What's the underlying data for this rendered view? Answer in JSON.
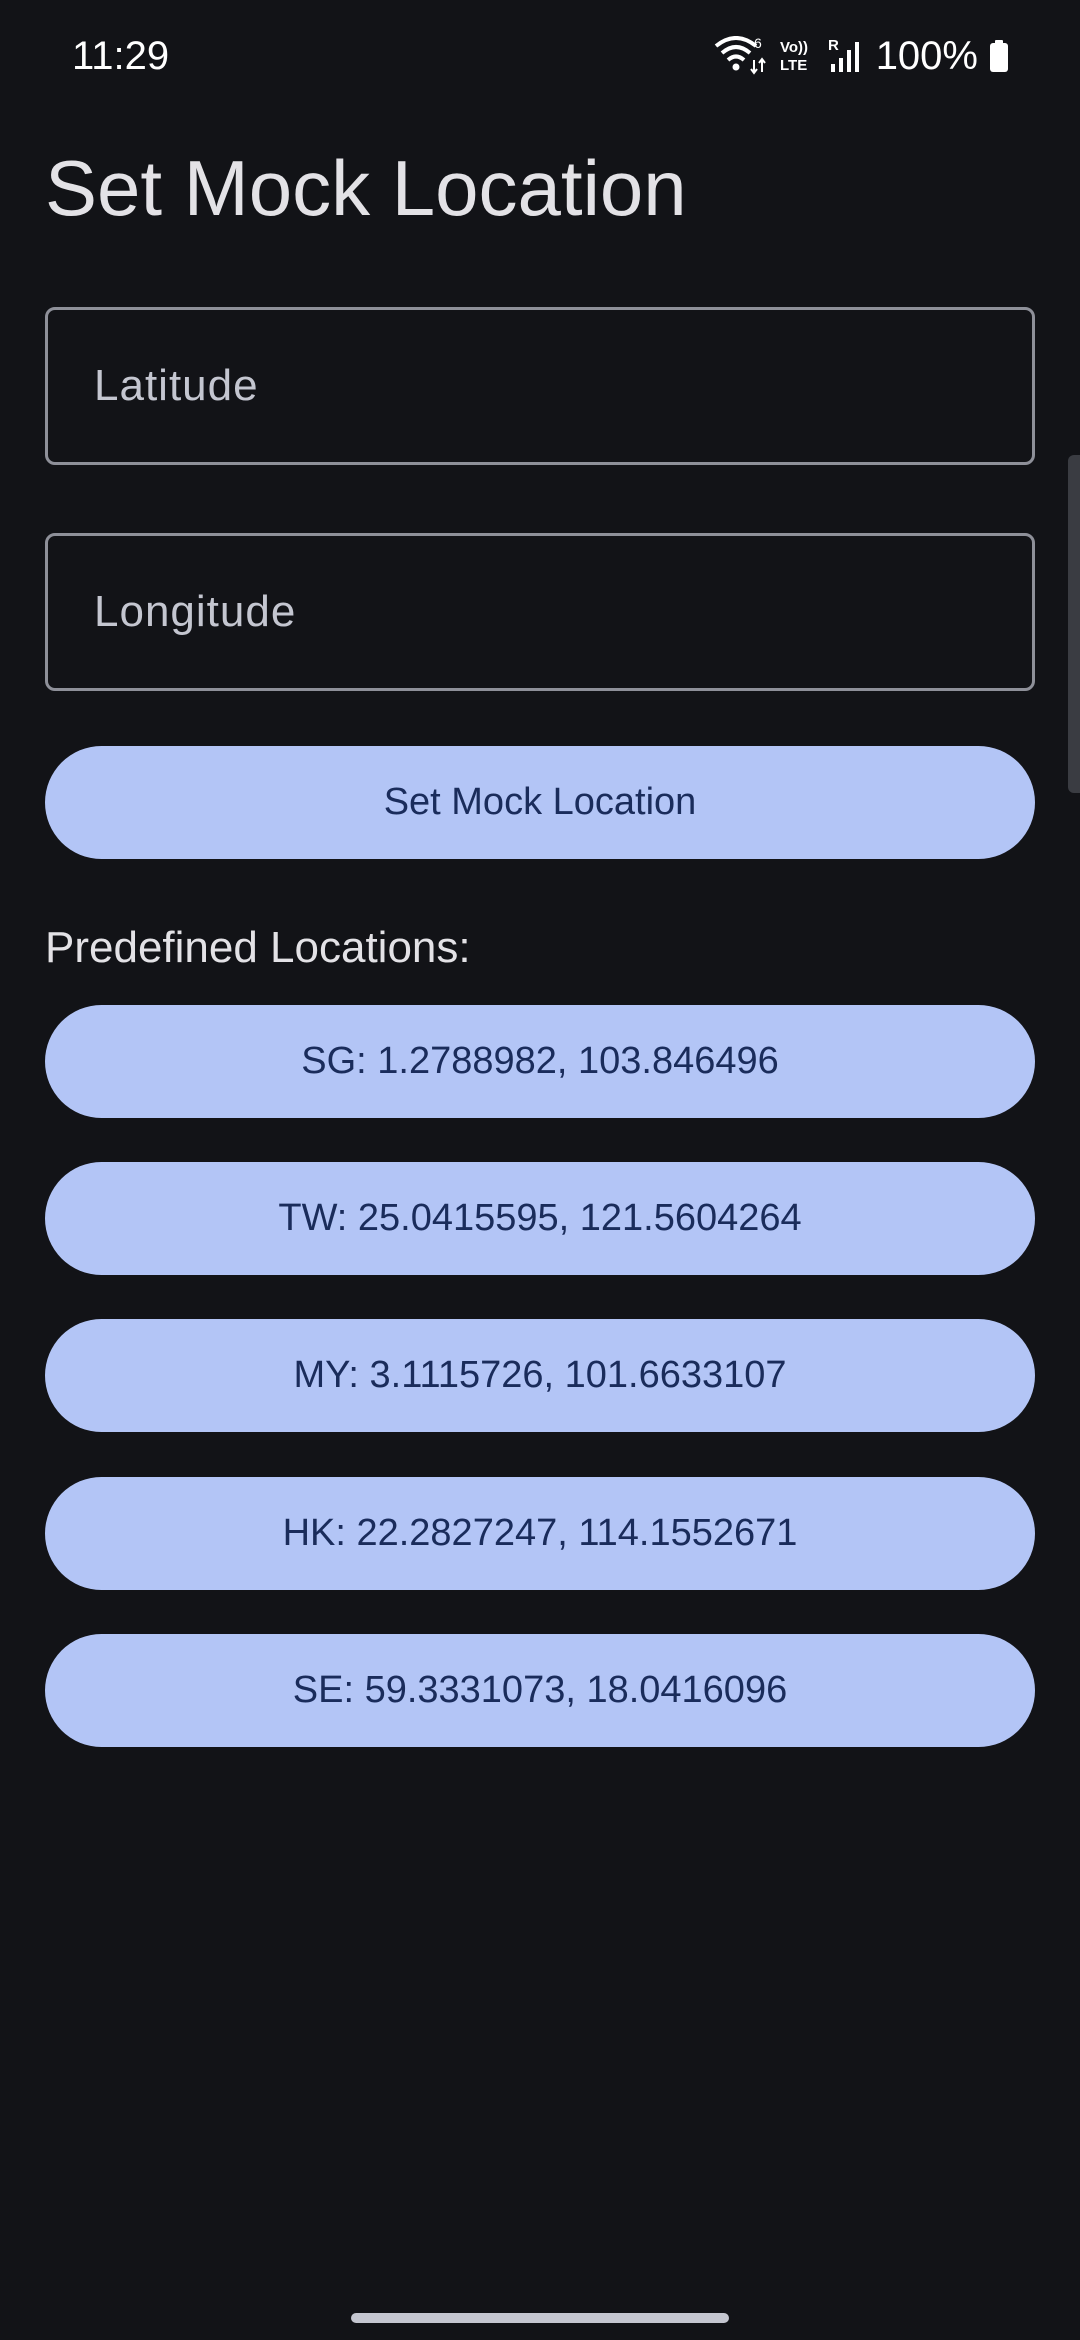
{
  "status_bar": {
    "time": "11:29",
    "battery_percent": "100%",
    "icons": [
      "wifi-6-icon",
      "volte-icon",
      "signal-roaming-icon",
      "battery-full-icon"
    ],
    "wifi_badge": "6",
    "volte_text_top": "Vo))",
    "volte_text_bottom": "LTE",
    "roaming_letter": "R"
  },
  "page": {
    "title": "Set Mock Location"
  },
  "form": {
    "latitude": {
      "placeholder": "Latitude",
      "value": ""
    },
    "longitude": {
      "placeholder": "Longitude",
      "value": ""
    },
    "submit_label": "Set Mock Location"
  },
  "predefined": {
    "heading": "Predefined Locations:",
    "items": [
      {
        "label": "SG: 1.2788982, 103.846496"
      },
      {
        "label": "TW: 25.0415595, 121.5604264"
      },
      {
        "label": "MY: 3.1115726, 101.6633107"
      },
      {
        "label": "HK: 22.2827247, 114.1552671"
      },
      {
        "label": "SE: 59.3331073, 18.0416096"
      }
    ]
  },
  "colors": {
    "background": "#121317",
    "button_fill": "#b3c5f6",
    "button_text": "#1a2c5b",
    "field_border": "#8e9099",
    "text_primary": "#e3e2e6"
  }
}
